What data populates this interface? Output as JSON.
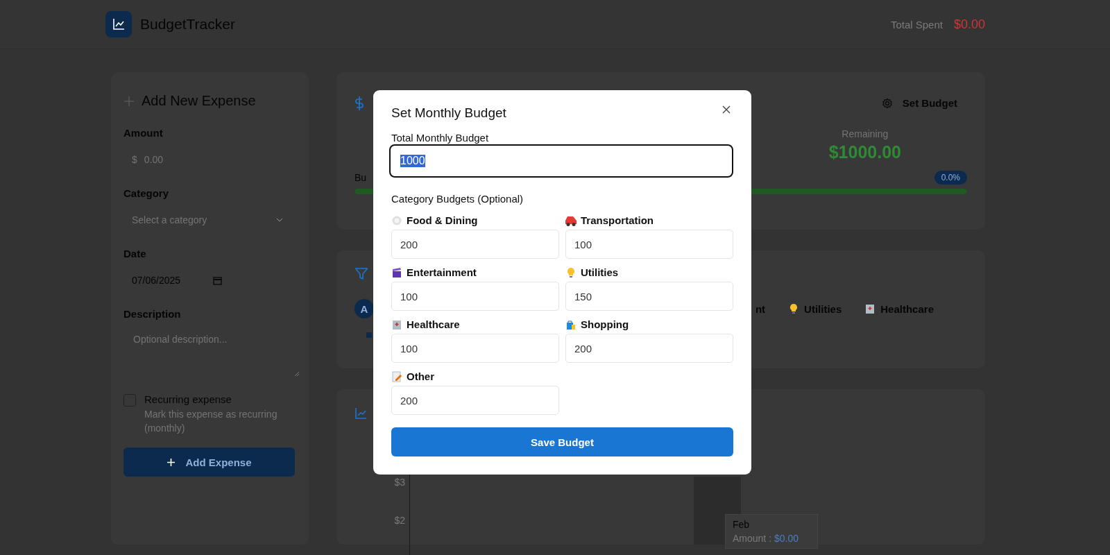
{
  "header": {
    "app_name": "BudgetTracker",
    "total_spent_label": "Total Spent",
    "total_spent": "$0.00"
  },
  "expense_form": {
    "title": "Add New Expense",
    "fields": [
      {
        "kind": "amount",
        "label": "Amount",
        "prefix": "$",
        "placeholder": "0.00"
      },
      {
        "kind": "select",
        "label": "Category",
        "placeholder": "Select a category"
      },
      {
        "kind": "date",
        "label": "Date",
        "value": "07/06/2025"
      },
      {
        "kind": "textarea",
        "label": "Description",
        "placeholder": "Optional description..."
      }
    ],
    "recurring": {
      "label": "Recurring expense",
      "hint": "Mark this expense as recurring (monthly)",
      "checked": false
    },
    "submit": "Add Expense"
  },
  "budget_card": {
    "set_budget_button": "Set Budget",
    "remaining_label": "Remaining",
    "remaining": "$1000.00",
    "progress_label": "Bu",
    "percent": "0.0%",
    "level": 1
  },
  "filters": {
    "chips": [
      {
        "label": "A",
        "selected": true
      },
      {
        "label": "nt",
        "selected": false
      },
      {
        "label": "Utilities",
        "selected": false
      },
      {
        "label": "Healthcare",
        "selected": false
      }
    ]
  },
  "chart": {
    "yticks": [
      "$3",
      "$2"
    ],
    "tooltip": {
      "title": "Feb",
      "label": "Amount :",
      "value": "$0.00"
    }
  },
  "modal": {
    "title": "Set Monthly Budget",
    "total_label": "Total Monthly Budget",
    "total_value": "1000",
    "category_heading": "Category Budgets (Optional)",
    "categories": [
      {
        "name": "Food & Dining",
        "value": "200"
      },
      {
        "name": "Transportation",
        "value": "100"
      },
      {
        "name": "Entertainment",
        "value": "100"
      },
      {
        "name": "Utilities",
        "value": "150"
      },
      {
        "name": "Healthcare",
        "value": "100"
      },
      {
        "name": "Shopping",
        "value": "200"
      },
      {
        "name": "Other",
        "value": "200"
      }
    ],
    "save_button": "Save Budget"
  }
}
